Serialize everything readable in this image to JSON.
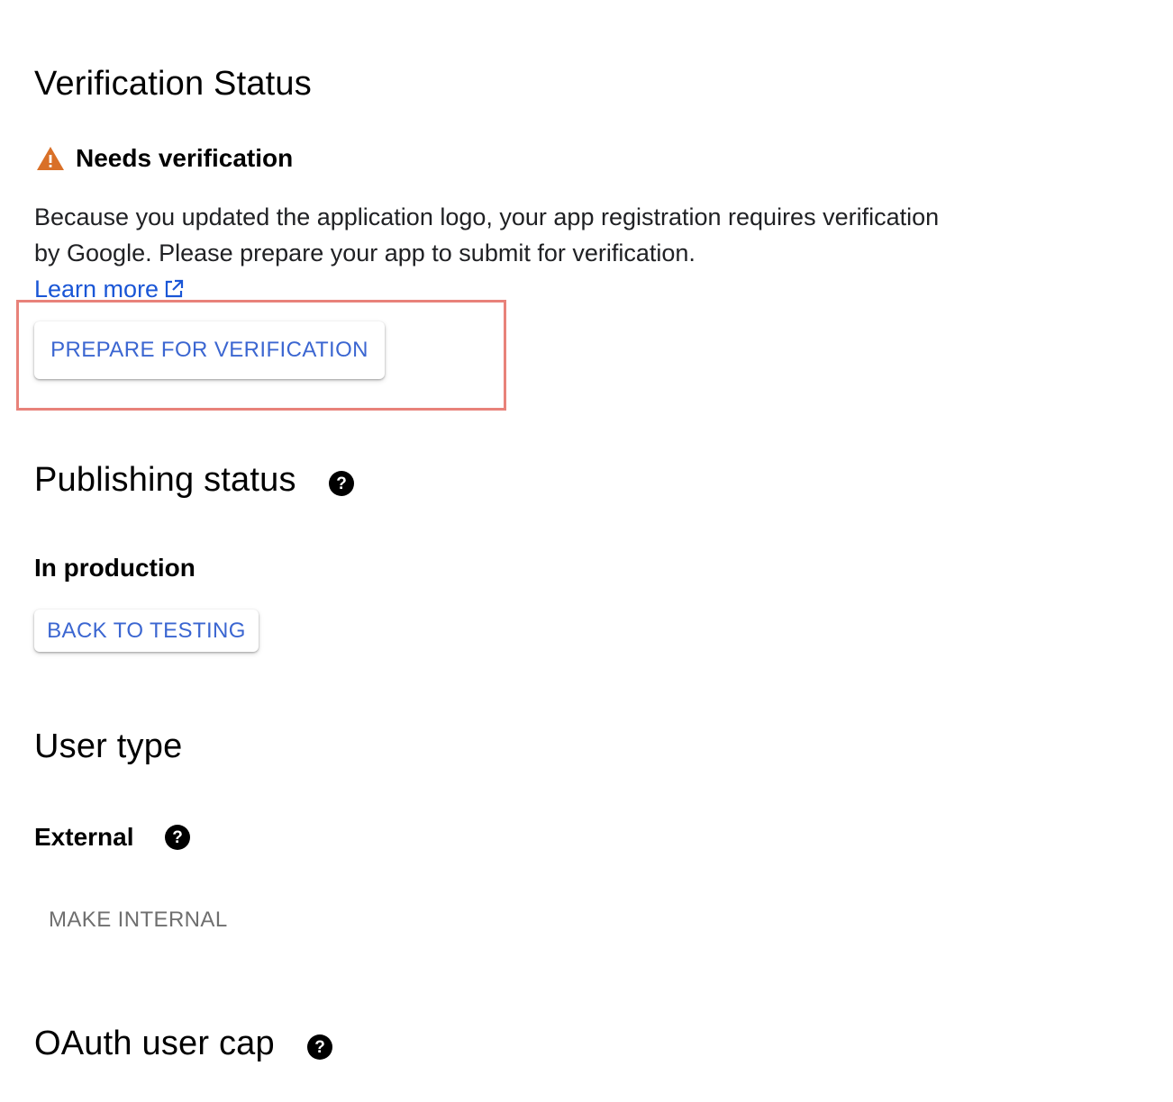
{
  "verification": {
    "title": "Verification Status",
    "status_label": "Needs verification",
    "status_icon": "warning-icon",
    "status_color": "#d97028",
    "description": "Because you updated the application logo, your app registration requires verification by Google. Please prepare your app to submit for verification.",
    "learn_more_label": "Learn more",
    "prepare_button_label": "PREPARE FOR VERIFICATION"
  },
  "publishing": {
    "title": "Publishing status",
    "status_label": "In production",
    "back_button_label": "BACK TO TESTING"
  },
  "user_type": {
    "title": "User type",
    "value_label": "External",
    "make_internal_label": "MAKE INTERNAL"
  },
  "oauth_cap": {
    "title": "OAuth user cap"
  },
  "colors": {
    "accent": "#3b66d1",
    "link": "#1a56d6",
    "highlight": "#e8827a",
    "disabled": "#6f6f6f"
  }
}
